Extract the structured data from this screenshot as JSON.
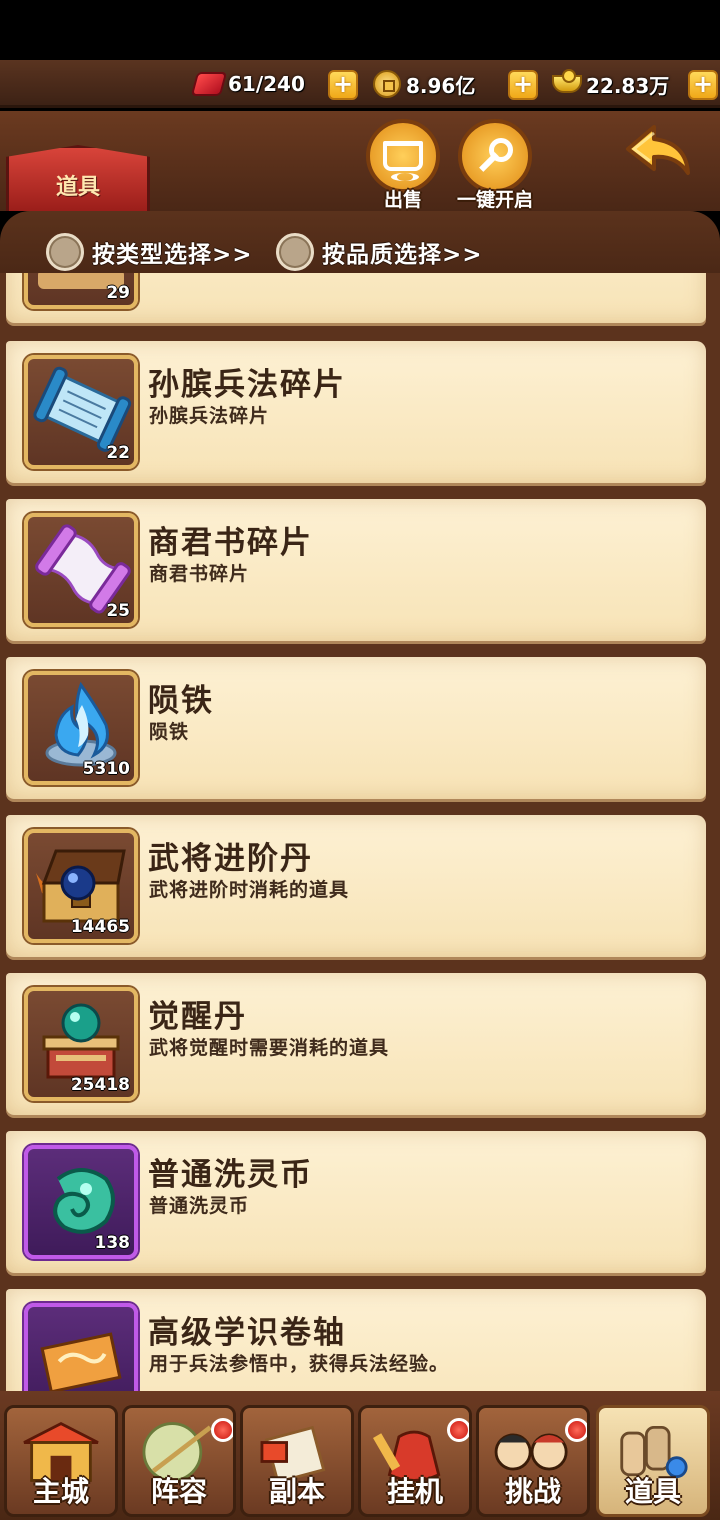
{
  "currency": {
    "stamina": "61/240",
    "copper": "8.96亿",
    "gold": "22.83万"
  },
  "header": {
    "tab_label": "道具",
    "sell_label": "出售",
    "open_all_label": "一键开启"
  },
  "filters": {
    "by_type": "按类型选择>>",
    "by_quality": "按品质选择>>"
  },
  "items": [
    {
      "name": "",
      "desc": "",
      "qty": "29"
    },
    {
      "name": "孙膑兵法碎片",
      "desc": "孙膑兵法碎片",
      "qty": "22"
    },
    {
      "name": "商君书碎片",
      "desc": "商君书碎片",
      "qty": "25"
    },
    {
      "name": "陨铁",
      "desc": "陨铁",
      "qty": "5310"
    },
    {
      "name": "武将进阶丹",
      "desc": "武将进阶时消耗的道具",
      "qty": "14465"
    },
    {
      "name": "觉醒丹",
      "desc": "武将觉醒时需要消耗的道具",
      "qty": "25418"
    },
    {
      "name": "普通洗灵币",
      "desc": "普通洗灵币",
      "qty": "138"
    },
    {
      "name": "高级学识卷轴",
      "desc": "用于兵法参悟中，获得兵法经验。",
      "qty": ""
    }
  ],
  "nav": [
    {
      "label": "主城"
    },
    {
      "label": "阵容"
    },
    {
      "label": "副本"
    },
    {
      "label": "挂机"
    },
    {
      "label": "挑战"
    },
    {
      "label": "道具"
    }
  ],
  "colors": {
    "wood_dark": "#4a2716",
    "parchment": "#fdf1d4",
    "accent_gold": "#f0a818",
    "tab_red": "#d8443a",
    "rare_purple": "#c05ae8"
  }
}
